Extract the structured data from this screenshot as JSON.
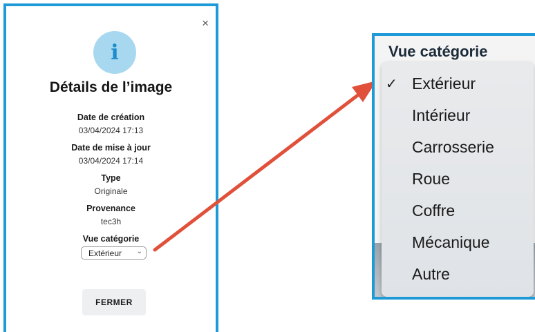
{
  "modal": {
    "close_label": "×",
    "info_glyph": "i",
    "title": "Détails de l’image",
    "fields": [
      {
        "label": "Date de création",
        "value": "03/04/2024 17:13"
      },
      {
        "label": "Date de mise à jour",
        "value": "03/04/2024 17:14"
      },
      {
        "label": "Type",
        "value": "Originale"
      },
      {
        "label": "Provenance",
        "value": "tec3h"
      }
    ],
    "category_label": "Vue catégorie",
    "category_selected": "Extérieur",
    "close_button_label": "FERMER"
  },
  "zoom": {
    "heading": "Vue catégorie",
    "check_glyph": "✓",
    "options": [
      "Extérieur",
      "Intérieur",
      "Carrosserie",
      "Roue",
      "Coffre",
      "Mécanique",
      "Autre"
    ]
  },
  "colors": {
    "frame": "#1e9bd7",
    "arrow": "#e0503a",
    "info_bg": "#a8d8f0",
    "info_glyph": "#1d8ccc"
  }
}
